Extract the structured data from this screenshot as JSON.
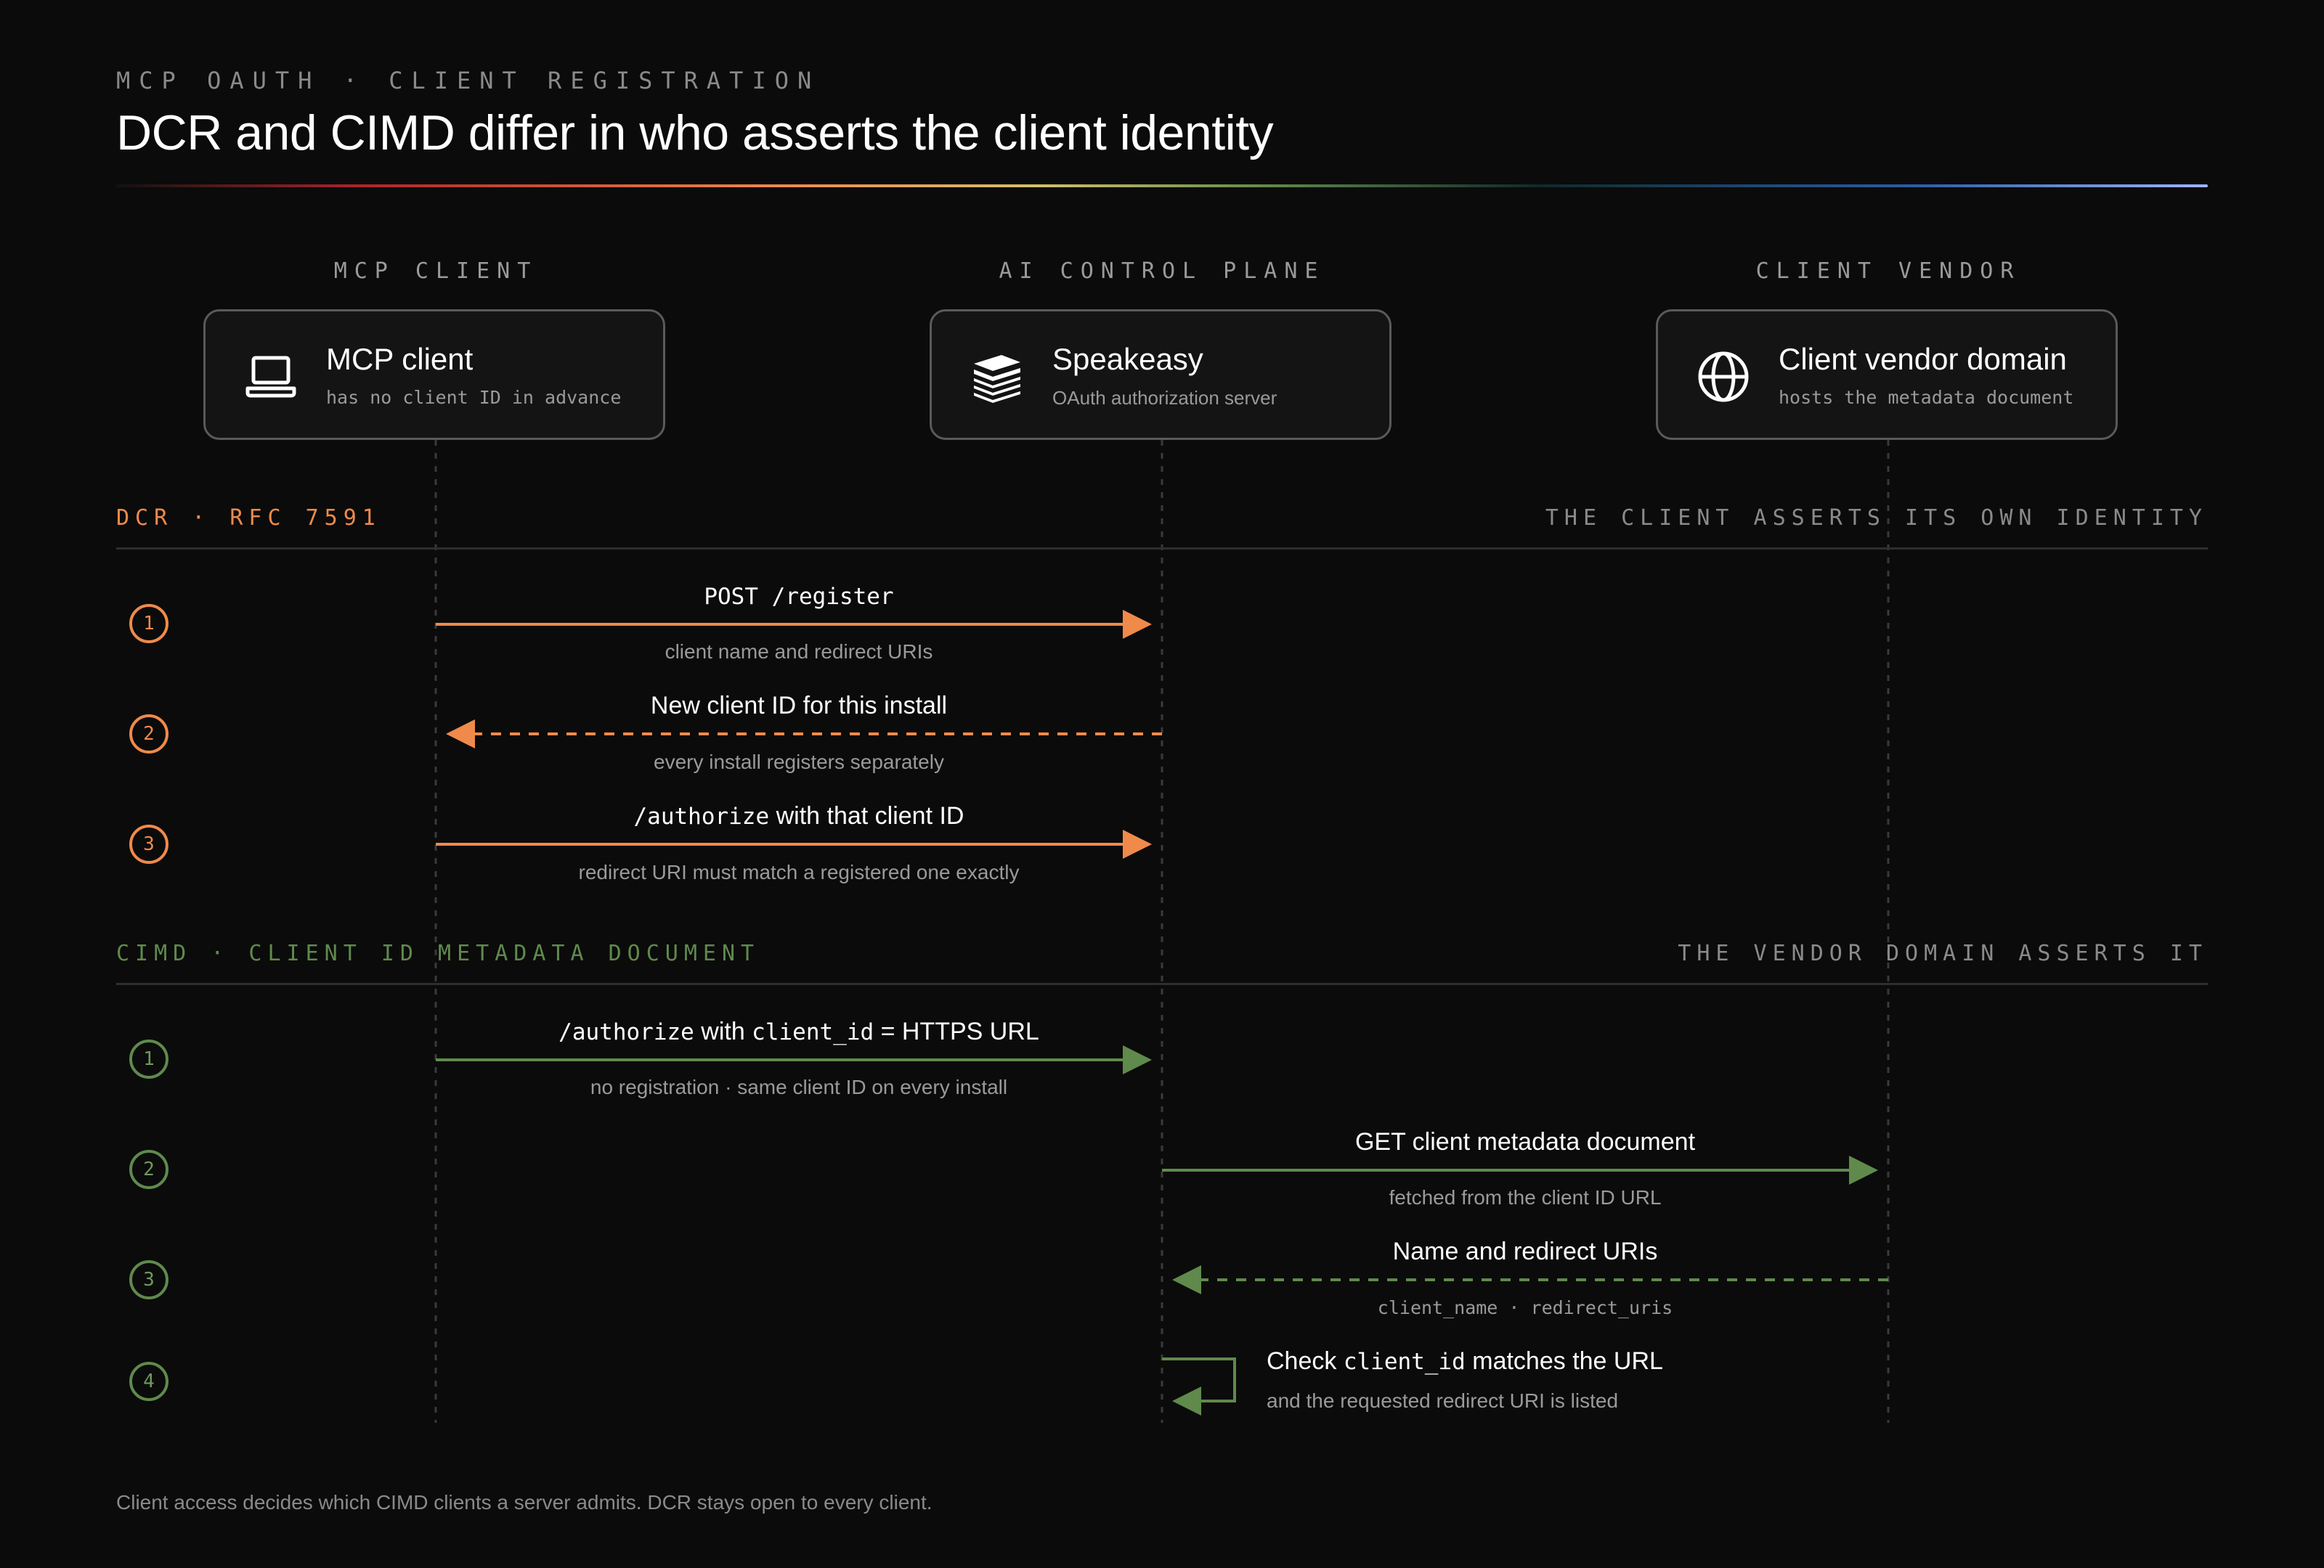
{
  "header": {
    "kicker": "MCP OAUTH · CLIENT REGISTRATION",
    "title": "DCR and CIMD differ in who asserts the client identity"
  },
  "lanes": [
    {
      "lane_label": "MCP CLIENT",
      "name": "MCP client",
      "subtitle": "has no client ID in advance",
      "icon": "laptop-icon"
    },
    {
      "lane_label": "AI CONTROL PLANE",
      "name": "Speakeasy",
      "subtitle": "OAuth authorization server",
      "icon": "stack-icon"
    },
    {
      "lane_label": "CLIENT VENDOR",
      "name": "Client vendor domain",
      "subtitle": "hosts the metadata document",
      "icon": "globe-icon"
    }
  ],
  "dcr": {
    "title": "DCR · RFC 7591",
    "tagline": "THE CLIENT ASSERTS ITS OWN IDENTITY",
    "color": "#f08a4b",
    "steps": [
      {
        "number": "1",
        "label_code": "POST /register",
        "label_text": "",
        "note": "client name and redirect URIs"
      },
      {
        "number": "2",
        "label_code": "",
        "label_text": "New client ID for this install",
        "note": "every install registers separately"
      },
      {
        "number": "3",
        "label_code": "/authorize",
        "label_text": " with that client ID",
        "note": "redirect URI must match a registered one exactly"
      }
    ]
  },
  "cimd": {
    "title": "CIMD · CLIENT ID METADATA DOCUMENT",
    "tagline": "THE VENDOR DOMAIN ASSERTS IT",
    "color": "#5f8a4c",
    "steps": [
      {
        "number": "1",
        "label_code": "/authorize",
        "label_text": " with ",
        "label_code2": "client_id",
        "label_text2": " = HTTPS URL",
        "note": "no registration · same client ID on every install"
      },
      {
        "number": "2",
        "label_text": "GET client metadata document",
        "note": "fetched from the client ID URL"
      },
      {
        "number": "3",
        "label_text": "Name and redirect URIs",
        "note": "client_name · redirect_uris"
      },
      {
        "number": "4",
        "label_text": "Check ",
        "label_code": "client_id",
        "label_text2": " matches the URL",
        "note": "and the requested redirect URI is listed"
      }
    ]
  },
  "footer": "Client access decides which CIMD clients a server admits. DCR stays open to every client."
}
